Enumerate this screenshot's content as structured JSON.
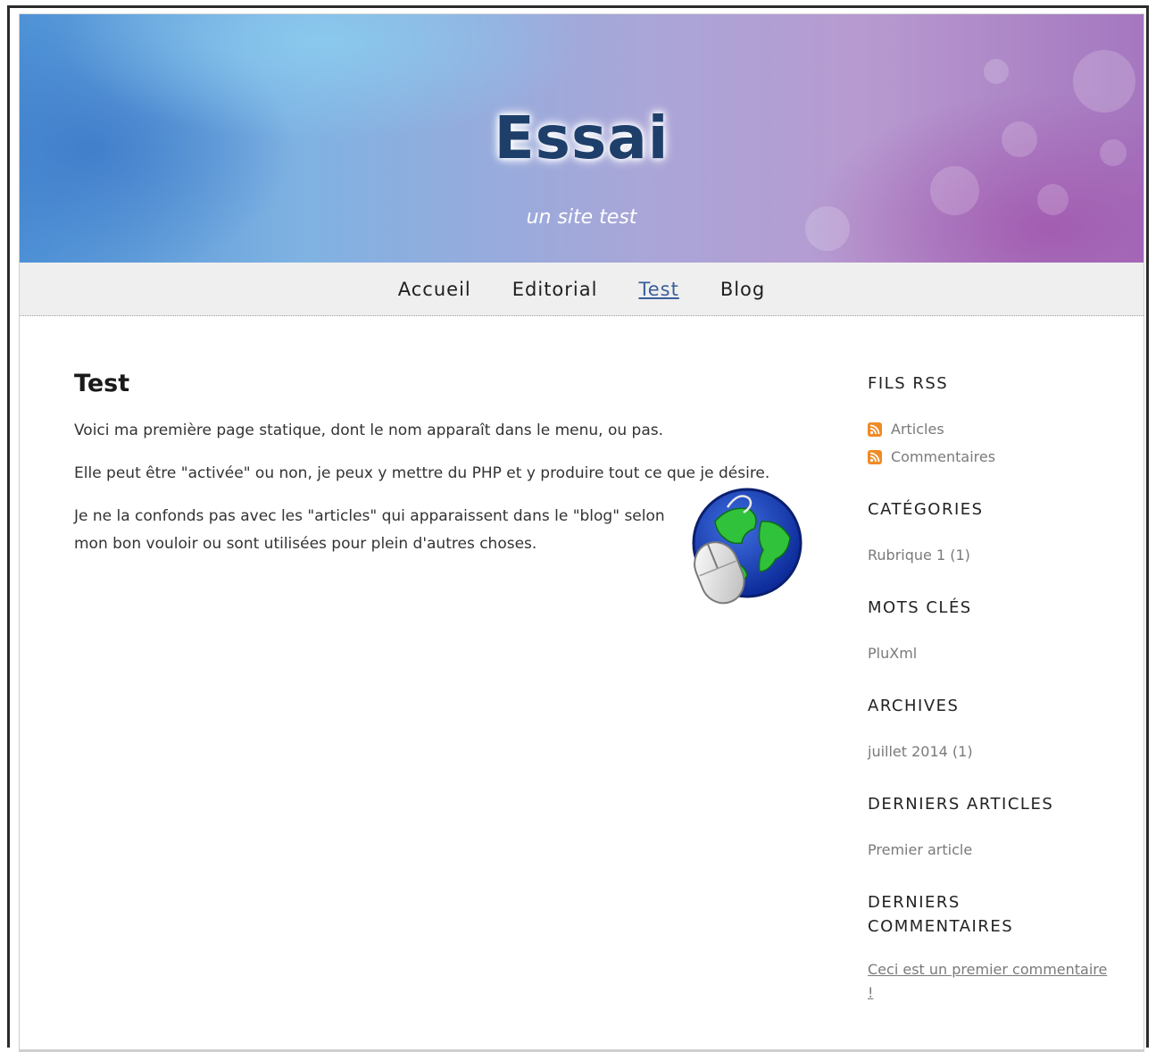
{
  "site": {
    "title": "Essai",
    "description": "un site test"
  },
  "nav": {
    "items": [
      {
        "label": "Accueil",
        "active": false
      },
      {
        "label": "Editorial",
        "active": false
      },
      {
        "label": "Test",
        "active": true
      },
      {
        "label": "Blog",
        "active": false
      }
    ]
  },
  "page": {
    "title": "Test",
    "paragraphs": [
      "Voici ma première page statique, dont le nom apparaît dans le menu, ou pas.",
      "Elle peut être \"activée\" ou non, je peux y mettre du PHP et y produire tout ce que je désire.",
      "Je ne la confonds pas avec les \"articles\" qui apparaissent dans le \"blog\" selon mon bon vouloir ou sont utilisées pour plein d'autres choses."
    ],
    "image_icon": "globe-mouse-icon"
  },
  "sidebar": {
    "rss": {
      "heading": "FILS RSS",
      "items": [
        "Articles",
        "Commentaires"
      ],
      "icon": "rss-icon"
    },
    "categories": {
      "heading": "CATÉGORIES",
      "items": [
        "Rubrique 1 (1)"
      ]
    },
    "tags": {
      "heading": "MOTS CLÉS",
      "items": [
        "PluXml"
      ]
    },
    "archives": {
      "heading": "ARCHIVES",
      "items": [
        "juillet 2014 (1)"
      ]
    },
    "latest_articles": {
      "heading": "DERNIERS ARTICLES",
      "items": [
        "Premier article"
      ]
    },
    "latest_comments": {
      "heading": "DERNIERS COMMENTAIRES",
      "items": [
        "Ceci est un premier commentaire !"
      ]
    }
  },
  "colors": {
    "title": "#1f3f6b",
    "active_link": "#3a5f9a",
    "rss": "#f08a24",
    "navbar_bg": "#efefef"
  }
}
